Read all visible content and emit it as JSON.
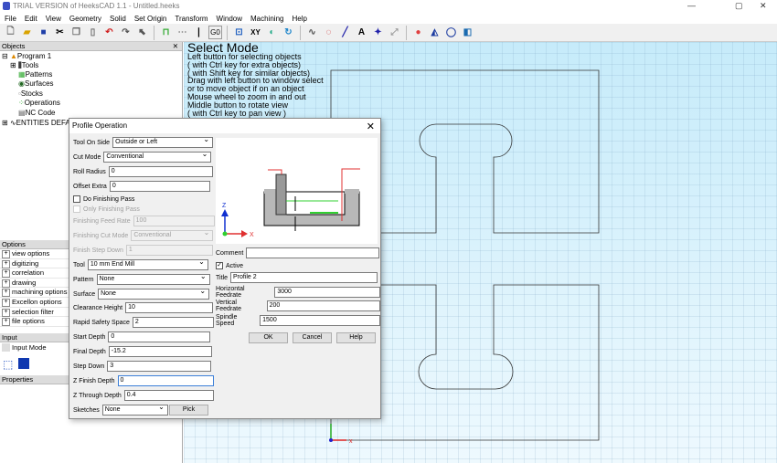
{
  "window": {
    "title": "TRIAL VERSION of HeeksCAD 1.1 - Untitled.heeks",
    "minimize": "—",
    "maximize": "▢",
    "close": "✕"
  },
  "menu": [
    "File",
    "Edit",
    "View",
    "Geometry",
    "Solid",
    "Set Origin",
    "Transform",
    "Window",
    "Machining",
    "Help"
  ],
  "toolbar": {
    "g0": "G0",
    "xy": "XY",
    "text": "A"
  },
  "objects": {
    "title": "Objects",
    "close": "✕",
    "items": [
      "Program 1",
      "Tools",
      "Patterns",
      "Surfaces",
      "Stocks",
      "Operations",
      "NC Code",
      "ENTITIES DEFA"
    ]
  },
  "options": {
    "title": "Options",
    "items": [
      "view options",
      "digitizing",
      "correlation",
      "drawing",
      "machining options",
      "Excellon options",
      "selection filter",
      "file options"
    ]
  },
  "input": {
    "title": "Input",
    "mode": "Input Mode"
  },
  "properties": {
    "title": "Properties"
  },
  "help": {
    "title": "Select Mode",
    "lines": [
      "Left button for selecting objects",
      "( with Ctrl key for extra objects)",
      "( with Shift key for similar objects)",
      "Drag with left button to window select",
      "or to move object if on an object",
      "Mouse wheel to zoom in and out",
      "Middle button to rotate view",
      "( with Ctrl key to pan view )"
    ]
  },
  "dialog": {
    "title": "Profile Operation",
    "close": "✕",
    "tool_on_side": {
      "label": "Tool On Side",
      "value": "Outside or Left"
    },
    "cut_mode": {
      "label": "Cut Mode",
      "value": "Conventional"
    },
    "roll_radius": {
      "label": "Roll Radius",
      "value": "0"
    },
    "offset_extra": {
      "label": "Offset Extra",
      "value": "0"
    },
    "do_finishing": {
      "label": "Do Finishing Pass",
      "checked": false
    },
    "only_finishing": {
      "label": "Only Finishing Pass",
      "checked": false
    },
    "finishing_feed": {
      "label": "Finishing Feed Rate",
      "value": "100"
    },
    "finishing_cut_mode": {
      "label": "Finishing Cut Mode",
      "value": "Conventional"
    },
    "finish_step_down": {
      "label": "Finish Step Down",
      "value": "1"
    },
    "tool": {
      "label": "Tool",
      "value": "10 mm End Mill"
    },
    "pattern": {
      "label": "Pattern",
      "value": "None"
    },
    "surface": {
      "label": "Surface",
      "value": "None"
    },
    "clearance": {
      "label": "Clearance Height",
      "value": "10"
    },
    "rapid": {
      "label": "Rapid Safety Space",
      "value": "2"
    },
    "start_depth": {
      "label": "Start Depth",
      "value": "0"
    },
    "final_depth": {
      "label": "Final Depth",
      "value": "-15.2"
    },
    "step_down": {
      "label": "Step Down",
      "value": "3"
    },
    "z_finish": {
      "label": "Z Finish Depth",
      "value": "0"
    },
    "z_through": {
      "label": "Z Through Depth",
      "value": "0.4"
    },
    "sketches": {
      "label": "Sketches",
      "value": "None"
    },
    "pick": "Pick",
    "diagram": {
      "z": "Z",
      "x": "X"
    },
    "comment": {
      "label": "Comment",
      "value": ""
    },
    "active": {
      "label": "Active",
      "checked": true
    },
    "title_field": {
      "label": "Title",
      "value": "Profile 2"
    },
    "hfeed": {
      "label": "Horizontal Feedrate",
      "value": "3000"
    },
    "vfeed": {
      "label": "Vertical Feedrate",
      "value": "200"
    },
    "spindle": {
      "label": "Spindle Speed",
      "value": "1500"
    },
    "ok": "OK",
    "cancel": "Cancel",
    "help": "Help"
  },
  "colors": {
    "viewport": "#c8ecfa",
    "toolpath_red": "#e03030",
    "toolpath_green": "#30d030"
  }
}
